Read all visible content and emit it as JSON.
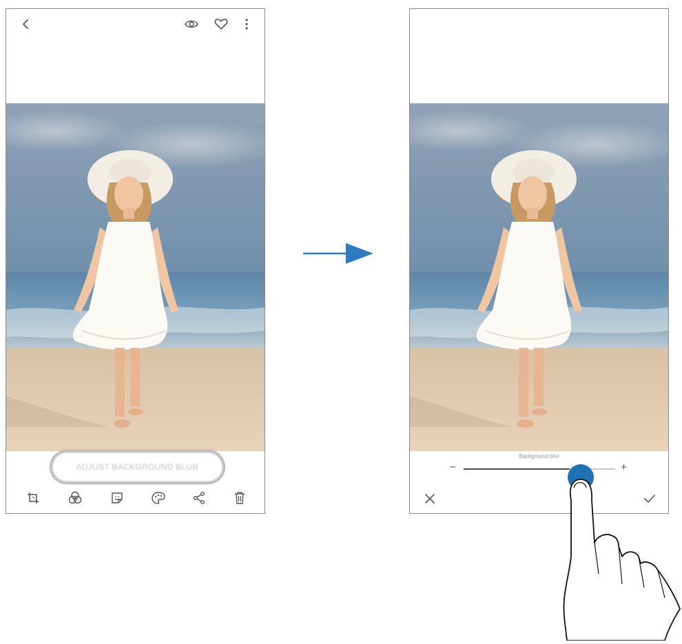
{
  "left_screen": {
    "topbar_icons": [
      "back-icon",
      "bixby-vision-icon",
      "favorite-icon",
      "more-options-icon"
    ],
    "blur_button_label": "ADJUST BACKGROUND BLUR",
    "toolbar_icons": [
      "crop-icon",
      "filter-icon",
      "sticker-icon",
      "paint-icon",
      "share-icon",
      "delete-icon"
    ]
  },
  "right_screen": {
    "slider_label": "Background blur",
    "slider_minus": "−",
    "slider_plus": "+",
    "slider_value_fraction": 0.7,
    "cancel_icon": "close-icon",
    "confirm_icon": "check-icon"
  },
  "colors": {
    "accent_blue": "#2f7bbf",
    "handle_blue": "#1f73b3"
  }
}
